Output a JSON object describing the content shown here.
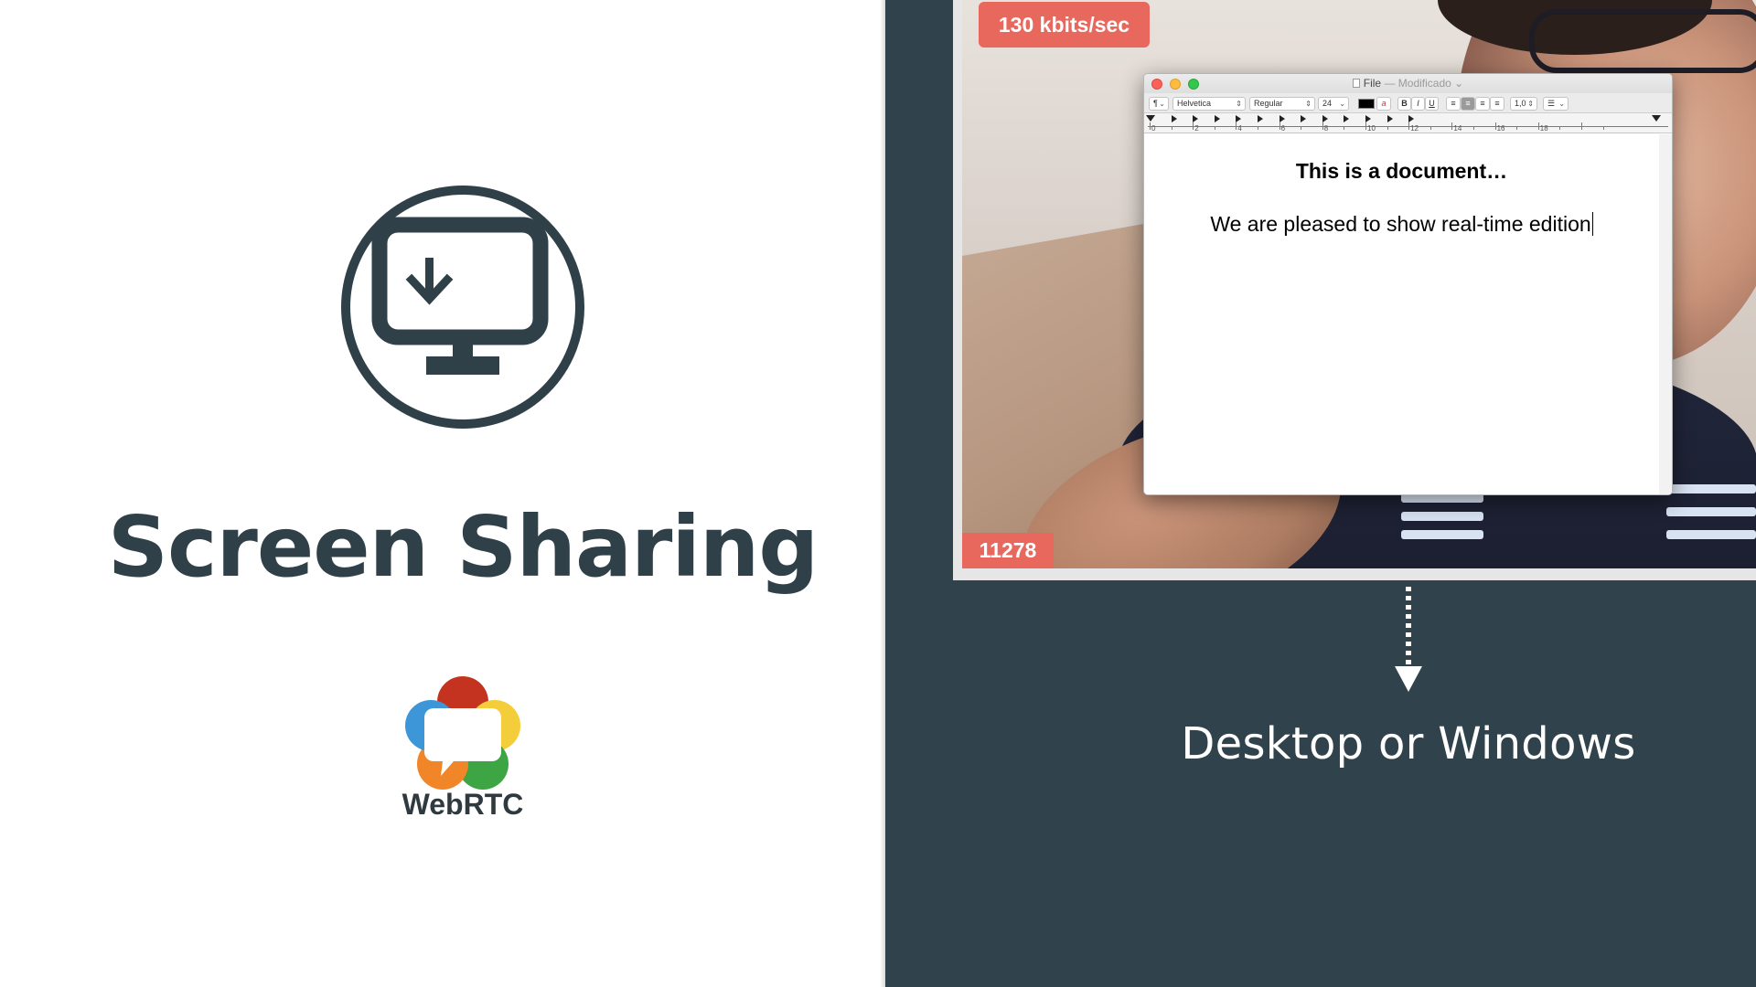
{
  "slide": {
    "title": "Screen Sharing",
    "caption": "Desktop or Windows",
    "logo_label": "WebRTC",
    "hero_icon": "monitor-download-icon"
  },
  "video": {
    "bitrate_badge": "130 kbits/sec",
    "stream_id_badge": "11278"
  },
  "document_window": {
    "title_file": "File",
    "title_separator": "—",
    "title_status": "Modificado ⌄",
    "toolbar": {
      "paragraph_style": "¶",
      "font_family": "Helvetica",
      "font_style": "Regular",
      "font_size": "24",
      "bold": "B",
      "italic": "I",
      "underline": "U",
      "line_spacing": "1,0"
    },
    "ruler_numbers": [
      "0",
      "2",
      "4",
      "6",
      "8",
      "10",
      "12",
      "14",
      "16",
      "18"
    ],
    "heading": "This is a document…",
    "body_text": "We are pleased to show real-time edition"
  },
  "colors": {
    "panel_dark": "#30424b",
    "title_color": "#2f4049",
    "badge_red": "#e8685e"
  }
}
